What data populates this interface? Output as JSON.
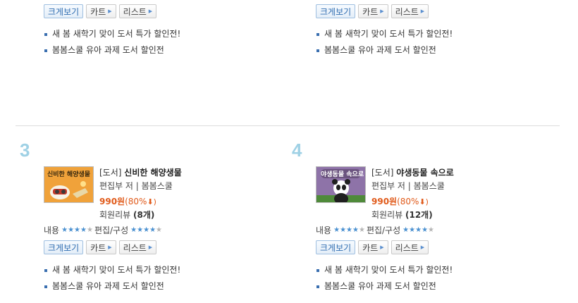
{
  "buttons": {
    "big_view": "크게보기",
    "cart": "카트",
    "list": "리스트"
  },
  "promos": [
    "새 봄 새학기 맞이 도서 특가 할인전!",
    "봄봄스쿨 유아 과제 도서 할인전"
  ],
  "books": [
    {
      "rank": "3",
      "category": "[도서]",
      "title": "신비한 해양생물",
      "cover_text": "신비한 해양생물",
      "author": "편집부 저 | 봄봄스쿨",
      "price": "990원",
      "discount": "(80%",
      "down": "⬇)",
      "review_label": "회원리뷰 ",
      "review_count": "(8개)",
      "rating_content_label": "내용",
      "rating_content": 4,
      "rating_edit_label": "편집/구성",
      "rating_edit": 4
    },
    {
      "rank": "4",
      "category": "[도서]",
      "title": "야생동물 속으로",
      "cover_text": "야생동물 속으로",
      "author": "편집부 저 | 봄봄스쿨",
      "price": "990원",
      "discount": "(80%",
      "down": "⬇)",
      "review_label": "회원리뷰 ",
      "review_count": "(12개)",
      "rating_content_label": "내용",
      "rating_content": 4,
      "rating_edit_label": "편집/구성",
      "rating_edit": 4
    }
  ],
  "colors": {
    "rank": "#9fd1e5",
    "price": "#e05a1a",
    "star_on": "#4a90d0",
    "star_off": "#b5b5b5"
  }
}
